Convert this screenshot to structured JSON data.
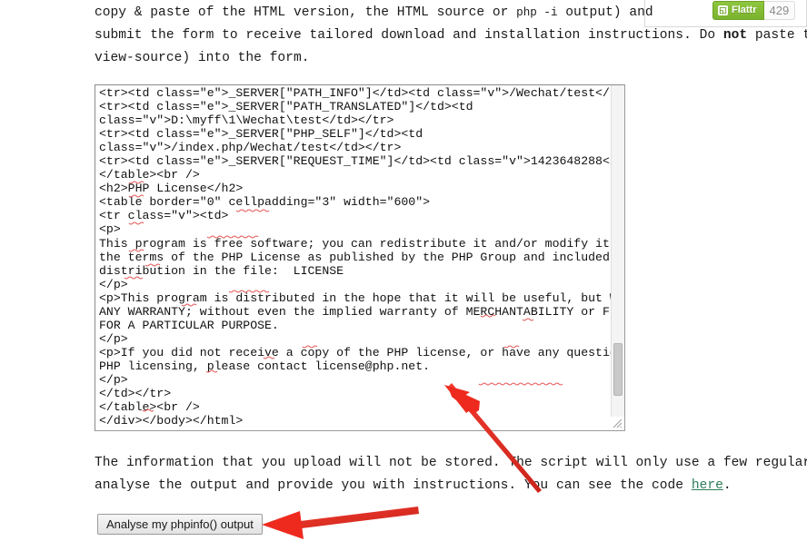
{
  "flattr": {
    "glyph_icon": "flattr-icon",
    "glyph_char": "◱",
    "label": "Flattr",
    "count": "429"
  },
  "intro": {
    "line1": "copy & paste of the HTML version, the HTML source or ",
    "line1_code": "php -i",
    "line1_tail": " output) and",
    "line2_a": "submit the form to receive tailored download and installation instructions. Do ",
    "line2_bold": "not",
    "line2_b": " paste the raw H",
    "line3": "view-source) into the form."
  },
  "code_area": {
    "name": "phpinfo-output-textarea",
    "content": "<tr><td class=\"e\">_SERVER[\"PATH_INFO\"]</td><td class=\"v\">/Wechat/test</td></tr>\n<tr><td class=\"e\">_SERVER[\"PATH_TRANSLATED\"]</td><td\nclass=\"v\">D:\\myff\\1\\Wechat\\test</td></tr>\n<tr><td class=\"e\">_SERVER[\"PHP_SELF\"]</td><td\nclass=\"v\">/index.php/Wechat/test</td></tr>\n<tr><td class=\"e\">_SERVER[\"REQUEST_TIME\"]</td><td class=\"v\">1423648288</td></tr>\n</table><br />\n<h2>PHP License</h2>\n<table border=\"0\" cellpadding=\"3\" width=\"600\">\n<tr class=\"v\"><td>\n<p>\nThis program is free software; you can redistribute it and/or modify it under\nthe terms of the PHP License as published by the PHP Group and included in the\ndistribution in the file:  LICENSE\n</p>\n<p>This program is distributed in the hope that it will be useful, but WITHOUT\nANY WARRANTY; without even the implied warranty of MERCHANTABILITY or FITNESS\nFOR A PARTICULAR PURPOSE.\n</p>\n<p>If you did not receive a copy of the PHP license, or have any questions about\nPHP licensing, please contact license@php.net.\n</p>\n</td></tr>\n</table><br />\n</div></body></html>",
    "scrollbar": "vertical-scrollbar",
    "resize_grip": "resize-grip-icon"
  },
  "outro": {
    "line1": "The information that you upload will not be stored. The script will only use a few regular express",
    "line2_a": "analyse the output and provide you with instructions. You can see the code ",
    "line2_link": "here",
    "line2_b": "."
  },
  "submit": {
    "label": "Analyse my phpinfo() output"
  },
  "annotations": {
    "arrow_1": "red-arrow-pointing-to-textarea",
    "arrow_2": "red-arrow-pointing-to-analyse-button"
  },
  "colors": {
    "accent_green": "#8ec63f",
    "link_green": "#2e7d5b",
    "arrow_red": "#ee2a1f",
    "text": "#1a1a1a"
  }
}
